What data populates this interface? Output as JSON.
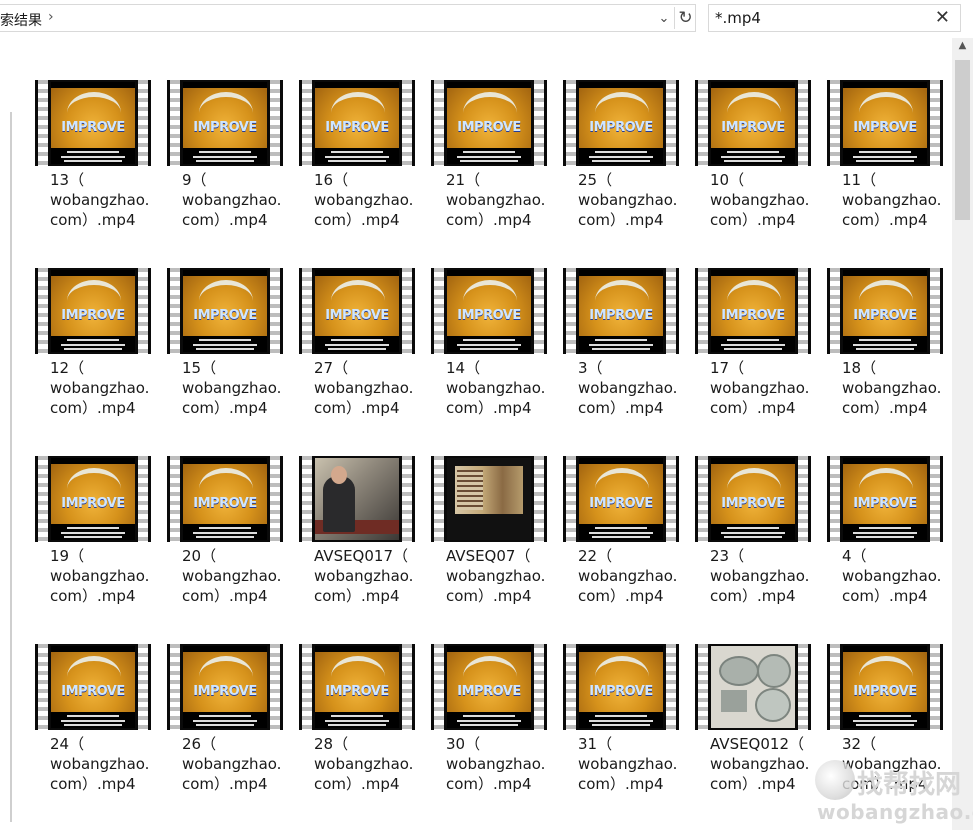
{
  "address_bar": {
    "path_text": "索结果",
    "separator": "›"
  },
  "search": {
    "value": "*.mp4"
  },
  "files": [
    {
      "name": "13（\nwobangzhao.\ncom）.mp4",
      "thumb": "improve"
    },
    {
      "name": "9（\nwobangzhao.\ncom）.mp4",
      "thumb": "improve"
    },
    {
      "name": "16（\nwobangzhao.\ncom）.mp4",
      "thumb": "improve"
    },
    {
      "name": "21（\nwobangzhao.\ncom）.mp4",
      "thumb": "improve"
    },
    {
      "name": "25（\nwobangzhao.\ncom）.mp4",
      "thumb": "improve"
    },
    {
      "name": "10（\nwobangzhao.\ncom）.mp4",
      "thumb": "improve"
    },
    {
      "name": "11（\nwobangzhao.\ncom）.mp4",
      "thumb": "improve"
    },
    {
      "name": "12（\nwobangzhao.\ncom）.mp4",
      "thumb": "improve"
    },
    {
      "name": "15（\nwobangzhao.\ncom）.mp4",
      "thumb": "improve"
    },
    {
      "name": "27（\nwobangzhao.\ncom）.mp4",
      "thumb": "improve"
    },
    {
      "name": "14（\nwobangzhao.\ncom）.mp4",
      "thumb": "improve"
    },
    {
      "name": "3（\nwobangzhao.\ncom）.mp4",
      "thumb": "improve"
    },
    {
      "name": "17（\nwobangzhao.\ncom）.mp4",
      "thumb": "improve"
    },
    {
      "name": "18（\nwobangzhao.\ncom）.mp4",
      "thumb": "improve"
    },
    {
      "name": "19（\nwobangzhao.\ncom）.mp4",
      "thumb": "improve"
    },
    {
      "name": "20（\nwobangzhao.\ncom）.mp4",
      "thumb": "improve"
    },
    {
      "name": "AVSEQ017（\nwobangzhao.\ncom）.mp4",
      "thumb": "lecture"
    },
    {
      "name": "AVSEQ07（\nwobangzhao.\ncom）.mp4",
      "thumb": "painting"
    },
    {
      "name": "22（\nwobangzhao.\ncom）.mp4",
      "thumb": "improve"
    },
    {
      "name": "23（\nwobangzhao.\ncom）.mp4",
      "thumb": "improve"
    },
    {
      "name": "4（\nwobangzhao.\ncom）.mp4",
      "thumb": "improve"
    },
    {
      "name": "24（\nwobangzhao.\ncom）.mp4",
      "thumb": "improve"
    },
    {
      "name": "26（\nwobangzhao.\ncom）.mp4",
      "thumb": "improve"
    },
    {
      "name": "28（\nwobangzhao.\ncom）.mp4",
      "thumb": "improve"
    },
    {
      "name": "30（\nwobangzhao.\ncom）.mp4",
      "thumb": "improve"
    },
    {
      "name": "31（\nwobangzhao.\ncom）.mp4",
      "thumb": "improve"
    },
    {
      "name": "AVSEQ012（\nwobangzhao.\ncom）.mp4",
      "thumb": "bowls"
    },
    {
      "name": "32（\nwobangzhao.\ncom）.mp4",
      "thumb": "improve"
    }
  ],
  "thumbnail_brand": "IMPROVE",
  "watermark": {
    "line1": "找帮找网",
    "line2": "wobangzhao.com"
  },
  "icons": {
    "dropdown": "chevron-down-icon",
    "refresh": "refresh-icon",
    "clear": "close-icon",
    "scroll_up": "scroll-up-arrow-icon"
  }
}
